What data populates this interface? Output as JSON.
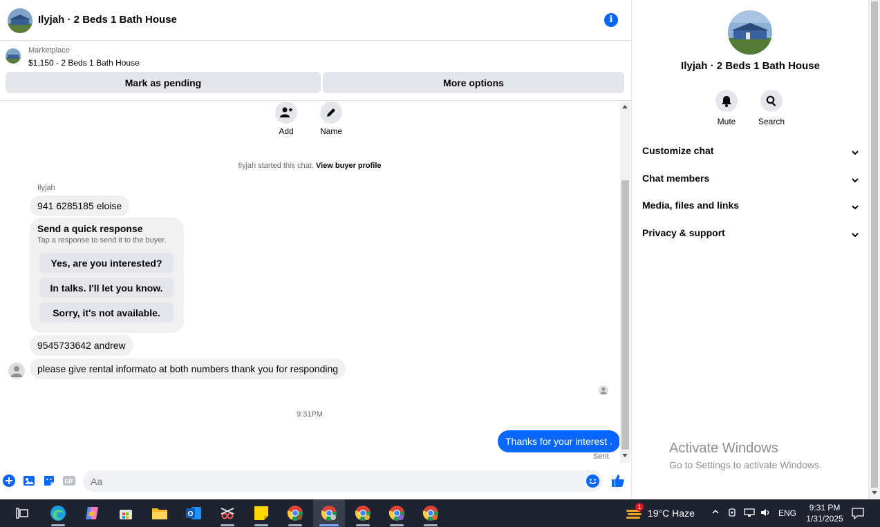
{
  "header": {
    "title": "Ilyjah · 2 Beds 1 Bath House"
  },
  "listing": {
    "label": "Marketplace",
    "price_title": "$1,150 - 2 Beds 1 Bath House",
    "pending_btn": "Mark as pending",
    "more_btn": "More options"
  },
  "chat_actions": {
    "add": "Add",
    "name": "Name"
  },
  "system": {
    "started": "Ilyjah started this chat.",
    "profile_link": "View buyer profile"
  },
  "sender_name": "Ilyjah",
  "messages": {
    "m1": "941 6285185 eloise",
    "m2": "9545733642 andrew",
    "m3": "please give rental informato at both numbers thank you for responding"
  },
  "quick_response": {
    "title": "Send a quick response",
    "subtitle": "Tap a response to send it to the buyer.",
    "options": [
      "Yes, are you interested?",
      "In talks. I'll let you know.",
      "Sorry, it's not available."
    ]
  },
  "timestamp": "9:31PM",
  "outgoing": {
    "text": "Thanks for your interest .",
    "status": "Sent"
  },
  "composer": {
    "placeholder": "Aa"
  },
  "details": {
    "name": "Ilyjah · 2 Beds 1 Bath House",
    "mute": "Mute",
    "search": "Search",
    "sections": [
      "Customize chat",
      "Chat members",
      "Media, files and links",
      "Privacy & support"
    ]
  },
  "watermark": {
    "line1": "Activate Windows",
    "line2": "Go to Settings to activate Windows."
  },
  "taskbar": {
    "weather": "19°C  Haze",
    "weather_badge": "1",
    "lang": "ENG",
    "time": "9:31 PM",
    "date": "1/31/2025"
  },
  "colors": {
    "accent": "#0866ff",
    "bubble": "#f0f0f0",
    "taskbar": "#1f2330"
  }
}
